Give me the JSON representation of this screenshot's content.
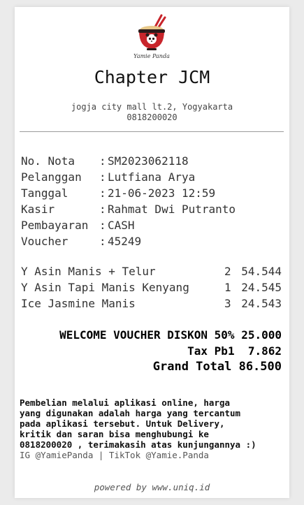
{
  "store": {
    "logo_text": "Yamie Panda",
    "name": "Chapter JCM",
    "address": "jogja city mall lt.2, Yogyakarta",
    "phone": "0818200020"
  },
  "info": [
    {
      "label": "No. Nota",
      "value": "SM2023062118"
    },
    {
      "label": "Pelanggan",
      "value": "Lutfiana Arya"
    },
    {
      "label": "Tanggal",
      "value": "21-06-2023 12:59"
    },
    {
      "label": "Kasir",
      "value": "Rahmat Dwi Putranto"
    },
    {
      "label": "Pembayaran",
      "value": "CASH"
    },
    {
      "label": "Voucher",
      "value": "45249"
    }
  ],
  "items": [
    {
      "name": "Y Asin Manis + Telur",
      "qty": "2",
      "price": "54.544"
    },
    {
      "name": "Y Asin Tapi Manis Kenyang",
      "qty": "1",
      "price": "24.545"
    },
    {
      "name": "Ice Jasmine Manis",
      "qty": "3",
      "price": "24.543"
    }
  ],
  "totals": {
    "voucher": "WELCOME VOUCHER DISKON 50% 25.000",
    "tax": "Tax Pb1  7.862",
    "grand": "Grand Total 86.500"
  },
  "footer": {
    "note": "Pembelian melalui aplikasi online, harga\nyang digunakan adalah harga yang tercantum\npada aplikasi tersebut. Untuk Delivery,\nkritik dan saran bisa menghubungi ke\n0818200020 , terimakasih atas kunjungannya :)",
    "social": "IG @YamiePanda | TikTok @Yamie.Panda",
    "powered": "powered by www.uniq.id"
  },
  "colors": {
    "logo_red": "#c8252b",
    "logo_dark": "#2a1a1a"
  }
}
